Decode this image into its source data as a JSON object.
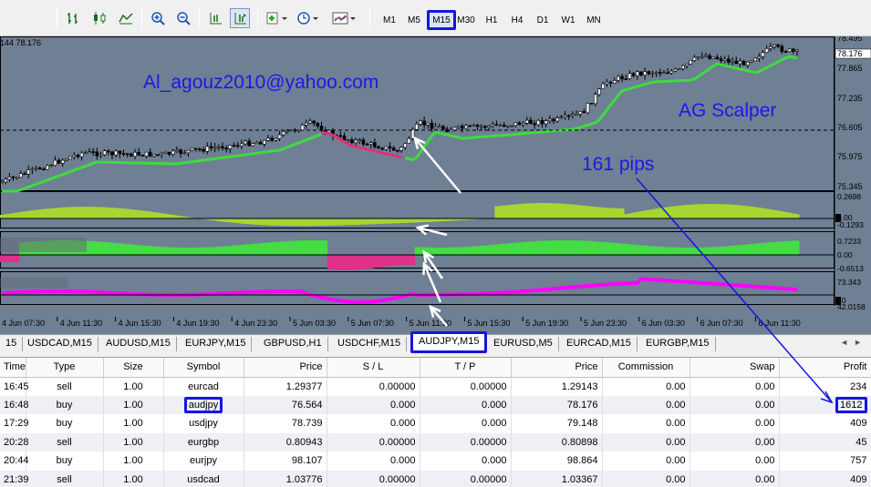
{
  "timeframes": {
    "m1": "M1",
    "m5": "M5",
    "m15": "M15",
    "m30": "M30",
    "h1": "H1",
    "h4": "H4",
    "d1": "D1",
    "w1": "W1",
    "mn": "MN"
  },
  "chart": {
    "header": "144 78.176",
    "email": "Al_agouz2010@yahoo.com",
    "indicator_name": "AG Scalper",
    "pips_note": "161 pips",
    "price_labels": [
      "78.495",
      "78.176",
      "77.865",
      "77.235",
      "76.605",
      "75.975",
      "75.345"
    ],
    "current_price": "78.176",
    "ind1_labels": [
      "0.2698",
      "0.00",
      "-0.1293"
    ],
    "ind2_labels": [
      "0.7233",
      "0.00",
      "-0.6513"
    ],
    "ind3_labels": [
      "73.343",
      "50",
      "42.0158"
    ],
    "time_labels": [
      "4 Jun 07:30",
      "4 Jun 11:30",
      "4 Jun 15:30",
      "4 Jun 19:30",
      "4 Jun 23:30",
      "5 Jun 03:30",
      "5 Jun 07:30",
      "5 Jun 11:30",
      "5 Jun 15:30",
      "5 Jun 19:30",
      "5 Jun 23:30",
      "6 Jun 03:30",
      "6 Jun 07:30",
      "6 Jun 11:30"
    ],
    "colors": {
      "bg": "#6f7f94",
      "ma_up": "#3ddc3d",
      "ma_down": "#e0307a",
      "hist_lime": "#a6d633",
      "hist_green": "#44dd44",
      "hist_pink": "#e0308a",
      "rsi": "#ff00ff",
      "annot": "#1a1ae6"
    }
  },
  "tabs": [
    "15",
    "USDCAD,M15",
    "AUDUSD,M15",
    "EURJPY,M15",
    "GBPUSD,H1",
    "USDCHF,M15",
    "AUDJPY,M15",
    "EURUSD,M5",
    "EURCAD,M15",
    "EURGBP,M15"
  ],
  "active_tab": "AUDJPY,M15",
  "table": {
    "headers": [
      "Time",
      "Type",
      "Size",
      "Symbol",
      "Price",
      "S / L",
      "T / P",
      "Price",
      "Commission",
      "Swap",
      "Profit"
    ],
    "rows": [
      [
        "16:45",
        "sell",
        "1.00",
        "eurcad",
        "1.29377",
        "0.00000",
        "0.00000",
        "1.29143",
        "0.00",
        "0.00",
        "234"
      ],
      [
        "16:48",
        "buy",
        "1.00",
        "audjpy",
        "76.564",
        "0.000",
        "0.000",
        "78.176",
        "0.00",
        "0.00",
        "1612"
      ],
      [
        "17:29",
        "buy",
        "1.00",
        "usdjpy",
        "78.739",
        "0.000",
        "0.000",
        "79.148",
        "0.00",
        "0.00",
        "409"
      ],
      [
        "20:28",
        "sell",
        "1.00",
        "eurgbp",
        "0.80943",
        "0.00000",
        "0.00000",
        "0.80898",
        "0.00",
        "0.00",
        "45"
      ],
      [
        "20:44",
        "buy",
        "1.00",
        "eurjpy",
        "98.107",
        "0.000",
        "0.000",
        "98.864",
        "0.00",
        "0.00",
        "757"
      ],
      [
        "21:39",
        "sell",
        "1.00",
        "usdcad",
        "1.03776",
        "0.00000",
        "0.00000",
        "1.03367",
        "0.00",
        "0.00",
        "409"
      ]
    ]
  }
}
